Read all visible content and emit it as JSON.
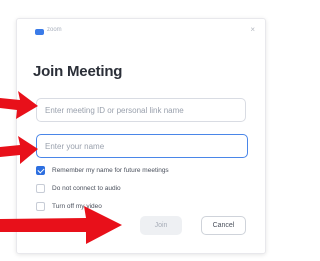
{
  "window": {
    "app_name": "zoom",
    "close_glyph": "×"
  },
  "dialog": {
    "title": "Join Meeting"
  },
  "fields": {
    "meeting_id_placeholder": "Enter meeting ID or personal link name",
    "name_placeholder": "Enter your name"
  },
  "options": [
    {
      "label": "Remember my name for future meetings",
      "checked": true
    },
    {
      "label": "Do not connect to audio",
      "checked": false
    },
    {
      "label": "Turn off my video",
      "checked": false
    }
  ],
  "buttons": {
    "join_label": "Join",
    "cancel_label": "Cancel"
  },
  "colors": {
    "accent": "#2d6fe0",
    "annotation_arrow": "#e8101a"
  },
  "icons": [
    "zoom-logo-icon",
    "close-icon",
    "checkmark-icon",
    "annotation-arrow-icon"
  ]
}
